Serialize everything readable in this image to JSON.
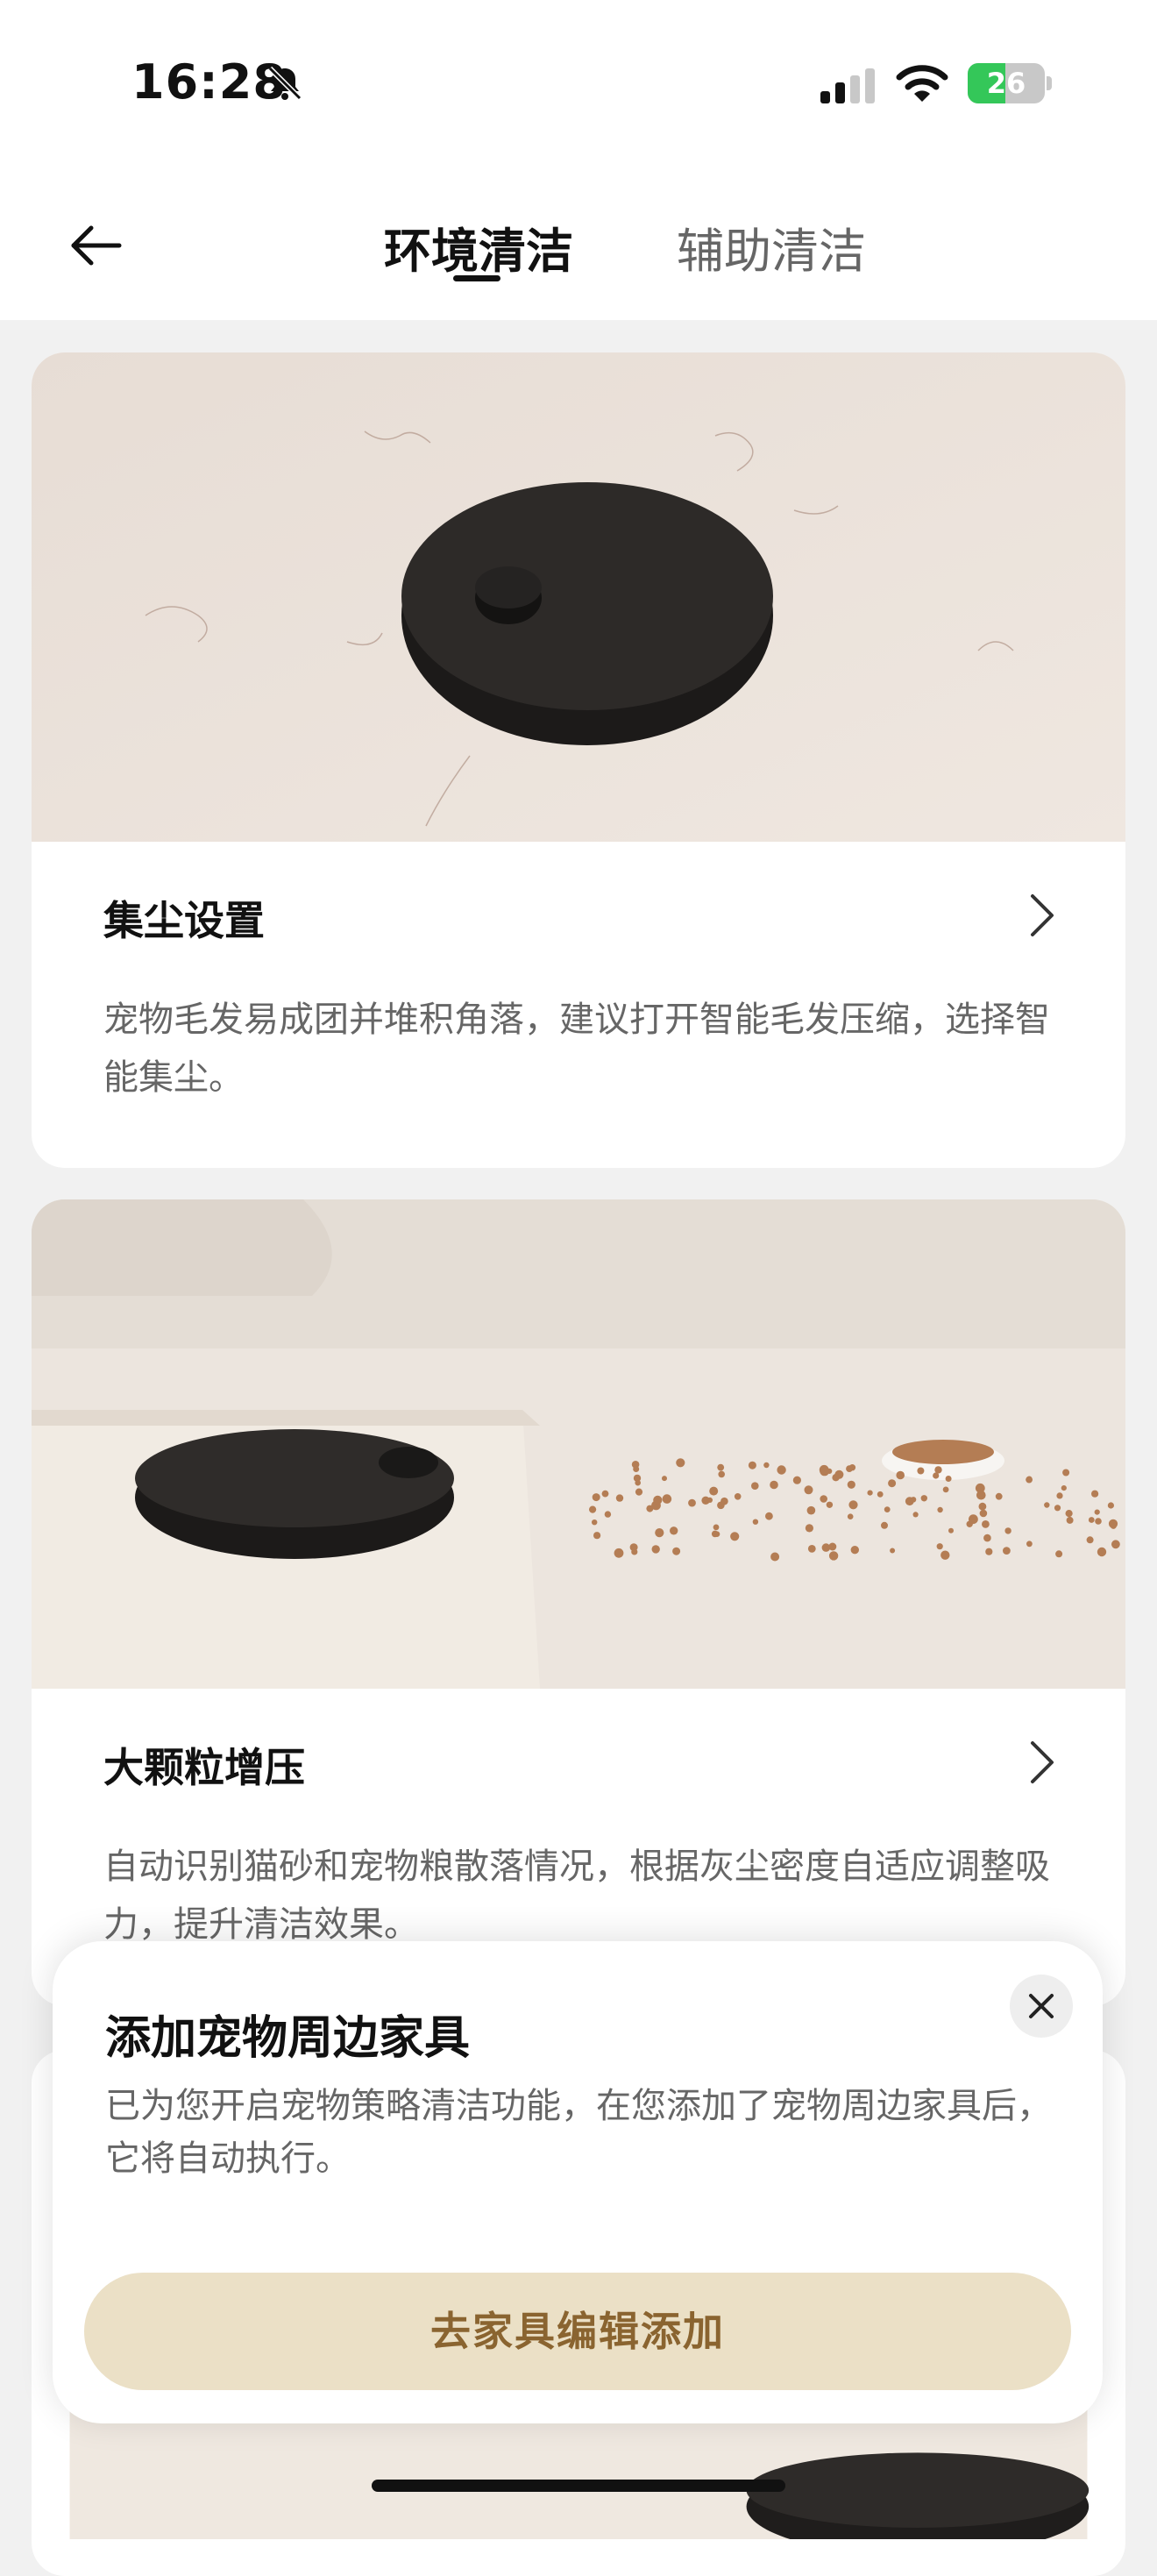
{
  "status_bar": {
    "time": "16:28",
    "battery_level": "26",
    "battery_fraction": 0.26,
    "icons": [
      "bell-slash-icon",
      "cellular-signal-icon",
      "wifi-icon",
      "battery-charging-icon"
    ]
  },
  "nav": {
    "back_icon": "arrow-left-icon",
    "tabs": [
      {
        "label": "环境清洁",
        "active": true
      },
      {
        "label": "辅助清洁",
        "active": false
      }
    ]
  },
  "cards": [
    {
      "title": "集尘设置",
      "description": "宠物毛发易成团并堆积角落，建议打开智能毛发压缩，选择智能集尘。",
      "image": "robot-vacuum-with-pet-hair-photo"
    },
    {
      "title": "大颗粒增压",
      "description": "自动识别猫砂和宠物粮散落情况，根据灰尘密度自适应调整吸力，提升清洁效果。",
      "image": "robot-vacuum-with-scattered-pet-food-photo"
    },
    {
      "image": "robot-vacuum-photo"
    }
  ],
  "sheet": {
    "title": "添加宠物周边家具",
    "message": "已为您开启宠物策略清洁功能，在您添加了宠物周边家具后，它将自动执行。",
    "button_label": "去家具编辑添加",
    "close_icon": "close-icon"
  },
  "colors": {
    "accent_button_bg": "#ebe0c6",
    "accent_button_text": "#8a6430",
    "battery_green": "#34c759"
  }
}
